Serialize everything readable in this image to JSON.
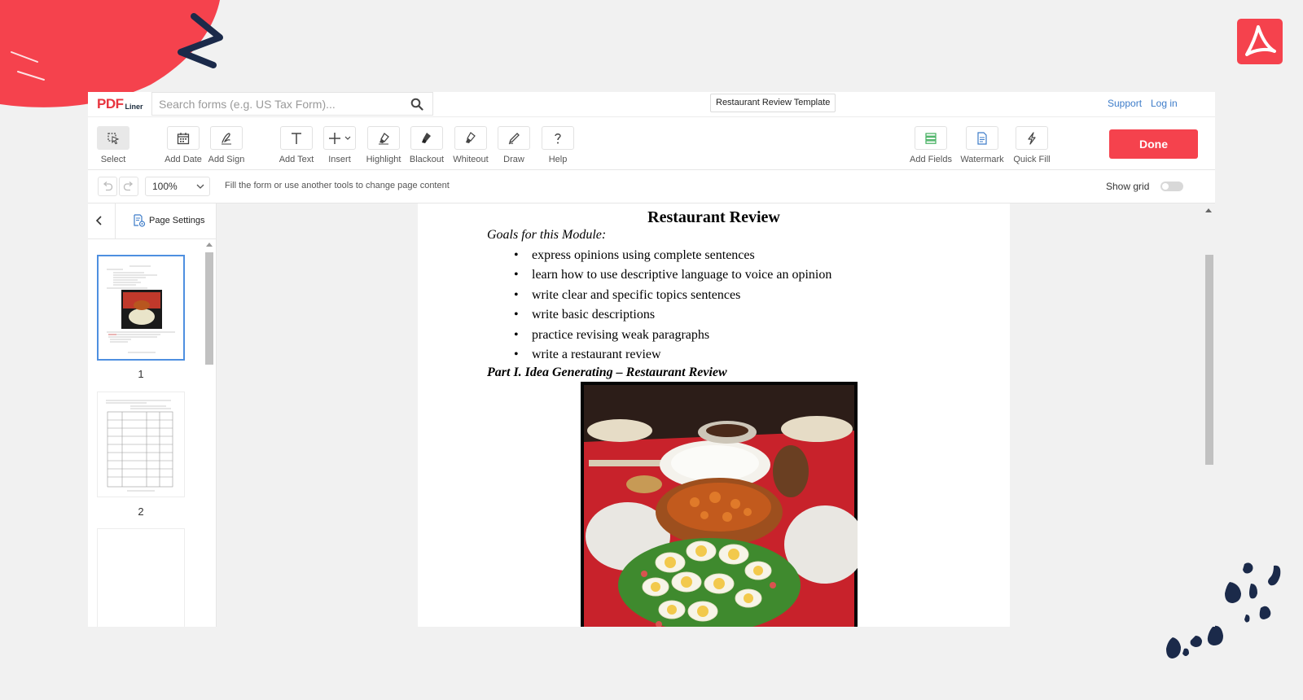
{
  "header": {
    "logo_main": "PDF",
    "logo_sub": "Liner",
    "search_placeholder": "Search forms (e.g. US Tax Form)...",
    "document_title": "Restaurant Review Template",
    "support_label": "Support",
    "login_label": "Log in"
  },
  "toolbar": {
    "tools": [
      {
        "label": "Select",
        "icon": "cursor-icon"
      },
      {
        "label": "Add Date",
        "icon": "calendar-icon"
      },
      {
        "label": "Add Sign",
        "icon": "signature-icon"
      },
      {
        "label": "Add Text",
        "icon": "text-icon"
      },
      {
        "label": "Insert",
        "icon": "plus-icon"
      },
      {
        "label": "Highlight",
        "icon": "highlighter-icon"
      },
      {
        "label": "Blackout",
        "icon": "blackout-icon"
      },
      {
        "label": "Whiteout",
        "icon": "whiteout-icon"
      },
      {
        "label": "Draw",
        "icon": "pen-icon"
      },
      {
        "label": "Help",
        "icon": "question-icon"
      },
      {
        "label": "Add Fields",
        "icon": "fields-icon"
      },
      {
        "label": "Watermark",
        "icon": "watermark-icon"
      },
      {
        "label": "Quick Fill",
        "icon": "lightning-icon"
      }
    ],
    "done_label": "Done"
  },
  "subbar": {
    "zoom_value": "100%",
    "hint": "Fill the form or use another tools to change page content",
    "show_grid_label": "Show grid",
    "show_grid_on": false
  },
  "sidebar": {
    "page_settings_label": "Page Settings",
    "thumbnails": [
      {
        "number": "1"
      },
      {
        "number": "2"
      }
    ]
  },
  "document": {
    "heading": "Restaurant Review",
    "goals_label": "Goals for this Module:",
    "goals": [
      "express opinions using complete sentences",
      "learn how to use descriptive language to voice an opinion",
      "write clear and specific topics sentences",
      "write basic descriptions",
      "practice revising weak paragraphs",
      "write a restaurant review"
    ],
    "part1_heading": "Part I.  Idea Generating – Restaurant Review"
  },
  "colors": {
    "accent": "#f5424d",
    "link": "#3d7cc9",
    "selection": "#4e8fe0",
    "deco_navy": "#1b2a4a"
  }
}
